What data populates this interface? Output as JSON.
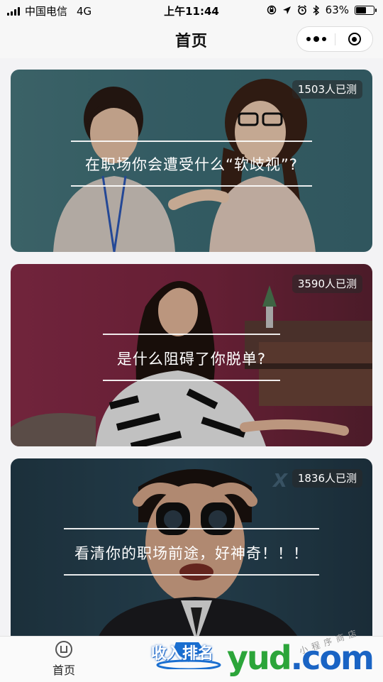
{
  "status_bar": {
    "carrier": "中国电信",
    "network": "4G",
    "time": "上午11:44",
    "battery_percent": "63%",
    "battery_level": 0.63,
    "icons": [
      "signal-icon",
      "rotation-lock-icon",
      "location-icon",
      "alarm-icon",
      "bluetooth-icon",
      "battery-icon"
    ]
  },
  "nav": {
    "title": "首页",
    "more_icon": "more-dots-icon",
    "close_icon": "target-close-icon"
  },
  "cards": [
    {
      "count": "1503人已测",
      "title": "在职场你会遭受什么“软歧视”?"
    },
    {
      "count": "3590人已测",
      "title": "是什么阻碍了你脱单?"
    },
    {
      "count": "1836人已测",
      "title": "看清你的职场前途，好神奇！！！"
    }
  ],
  "tab_bar": {
    "home_label": "首页",
    "home_icon": "home-tab-icon"
  },
  "watermark": {
    "badge_text": "收入排名",
    "brand": "yud",
    "suffix": ".com",
    "small_text": "小程序商店"
  }
}
